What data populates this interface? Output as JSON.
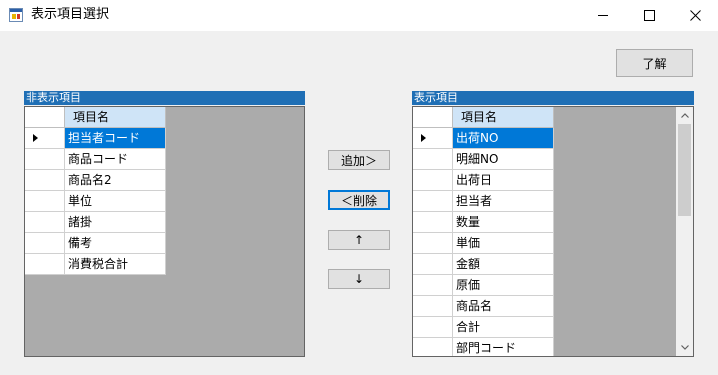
{
  "window": {
    "title": "表示項目選択",
    "icon": "windows-forms-app-icon"
  },
  "buttons": {
    "ok": "了解",
    "add": "追加＞",
    "delete": "＜削除",
    "up": "↑",
    "down": "↓"
  },
  "left_panel": {
    "header": "非表示項目",
    "column": "項目名",
    "rows": [
      "担当者コード",
      "商品コード",
      "商品名2",
      "単位",
      "諸掛",
      "備考",
      "消費税合計"
    ],
    "selected_index": 0
  },
  "right_panel": {
    "header": "表示項目",
    "column": "項目名",
    "rows": [
      "出荷NO",
      "明細NO",
      "出荷日",
      "担当者",
      "数量",
      "単価",
      "金額",
      "原価",
      "商品名",
      "合計",
      "部門コード"
    ],
    "selected_index": 0
  },
  "colors": {
    "selection": "#0078d7",
    "panel_header": "#1f6fb5",
    "grid_background": "#ababab",
    "column_header": "#cfe4f7"
  }
}
